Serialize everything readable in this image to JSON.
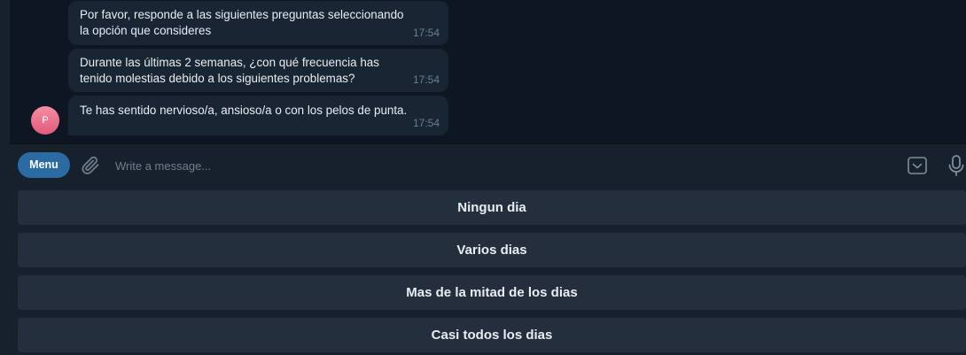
{
  "messages": [
    {
      "text": "Por favor, responde a las siguientes preguntas seleccionando la opción que consideres",
      "time": "17:54"
    },
    {
      "text": "Durante las últimas 2 semanas, ¿con qué frecuencia has tenido molestias debido a los siguientes problemas?",
      "time": "17:54"
    },
    {
      "text": "Te has sentido nervioso/a, ansioso/a o con los pelos de punta.",
      "time": "17:54"
    }
  ],
  "sender": {
    "avatar_letter": "P"
  },
  "composer": {
    "menu_label": "Menu",
    "placeholder": "Write a message...",
    "attach_icon": "paperclip-icon",
    "keyboard_icon": "keyboard-toggle-icon",
    "mic_icon": "microphone-icon"
  },
  "reply_keyboard": [
    "Ningun dia",
    "Varios dias",
    "Mas de la mitad de los dias",
    "Casi todos los dias"
  ],
  "colors": {
    "background": "#0e1621",
    "panel": "#17212b",
    "bubble": "#182533",
    "accent": "#2b6ba3",
    "reply_button": "#232f3c",
    "timestamp": "#6d7f8f"
  }
}
